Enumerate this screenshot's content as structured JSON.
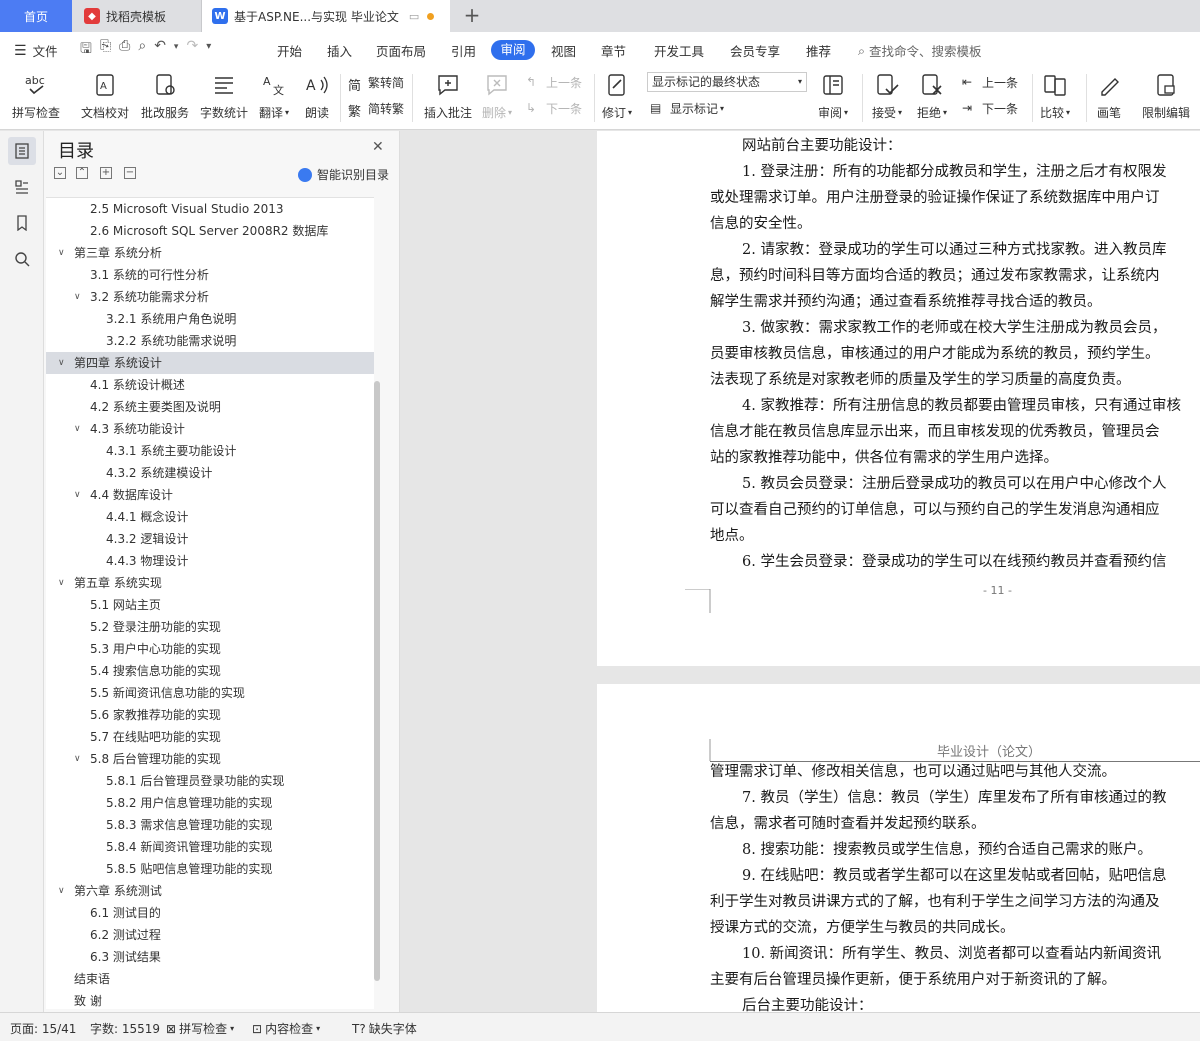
{
  "tabs": {
    "home": "首页",
    "template": "找稻壳模板",
    "doc": "基于ASP.NE...与实现 毕业论文"
  },
  "menu": {
    "file": "文件",
    "items": [
      "开始",
      "插入",
      "页面布局",
      "引用",
      "审阅",
      "视图",
      "章节",
      "开发工具",
      "会员专享",
      "推荐"
    ],
    "search": "查找命令、搜索模板"
  },
  "ribbon": {
    "spell": "拼写检查",
    "doccheck": "文档校对",
    "batch": "批改服务",
    "wordcount": "字数统计",
    "translate": "翻译",
    "read": "朗读",
    "trad": "繁转简",
    "simp": "简转繁",
    "comment": "插入批注",
    "delete": "删除",
    "prev": "上一条",
    "next": "下一条",
    "revise": "修订",
    "display_select": "显示标记的最终状态",
    "show_marks": "显示标记",
    "review": "审阅",
    "accept": "接受",
    "reject": "拒绝",
    "prev2": "上一条",
    "next2": "下一条",
    "compare": "比较",
    "pen": "画笔",
    "restrict": "限制编辑"
  },
  "toc": {
    "title": "目录",
    "smart": "智能识别目录",
    "items": [
      {
        "text": "2.5 Microsoft Visual Studio 2013",
        "level": 2,
        "arrow": ""
      },
      {
        "text": "2.6 Microsoft SQL Server 2008R2 数据库",
        "level": 2,
        "arrow": ""
      },
      {
        "text": "第三章  系统分析",
        "level": 1,
        "arrow": "v"
      },
      {
        "text": "3.1 系统的可行性分析",
        "level": 2,
        "arrow": ""
      },
      {
        "text": "3.2 系统功能需求分析",
        "level": 2,
        "arrow": "v"
      },
      {
        "text": "3.2.1 系统用户角色说明",
        "level": 3,
        "arrow": ""
      },
      {
        "text": "3.2.2 系统功能需求说明",
        "level": 3,
        "arrow": ""
      },
      {
        "text": "第四章  系统设计",
        "level": 1,
        "arrow": "v",
        "selected": true
      },
      {
        "text": "4.1 系统设计概述",
        "level": 2,
        "arrow": ""
      },
      {
        "text": "4.2  系统主要类图及说明",
        "level": 2,
        "arrow": ""
      },
      {
        "text": "4.3 系统功能设计",
        "level": 2,
        "arrow": "v"
      },
      {
        "text": "4.3.1 系统主要功能设计",
        "level": 3,
        "arrow": ""
      },
      {
        "text": "4.3.2 系统建模设计",
        "level": 3,
        "arrow": ""
      },
      {
        "text": "4.4 数据库设计",
        "level": 2,
        "arrow": "v"
      },
      {
        "text": "4.4.1  概念设计",
        "level": 3,
        "arrow": ""
      },
      {
        "text": "4.3.2  逻辑设计",
        "level": 3,
        "arrow": ""
      },
      {
        "text": "4.4.3  物理设计",
        "level": 3,
        "arrow": ""
      },
      {
        "text": "第五章  系统实现",
        "level": 1,
        "arrow": "v"
      },
      {
        "text": "5.1 网站主页",
        "level": 2,
        "arrow": ""
      },
      {
        "text": "5.2  登录注册功能的实现",
        "level": 2,
        "arrow": ""
      },
      {
        "text": "5.3 用户中心功能的实现",
        "level": 2,
        "arrow": ""
      },
      {
        "text": "5.4 搜索信息功能的实现",
        "level": 2,
        "arrow": ""
      },
      {
        "text": "5.5 新闻资讯信息功能的实现",
        "level": 2,
        "arrow": ""
      },
      {
        "text": "5.6 家教推荐功能的实现",
        "level": 2,
        "arrow": ""
      },
      {
        "text": "5.7 在线贴吧功能的实现",
        "level": 2,
        "arrow": ""
      },
      {
        "text": "5.8 后台管理功能的实现",
        "level": 2,
        "arrow": "v"
      },
      {
        "text": "5.8.1  后台管理员登录功能的实现",
        "level": 3,
        "arrow": ""
      },
      {
        "text": "5.8.2  用户信息管理功能的实现",
        "level": 3,
        "arrow": ""
      },
      {
        "text": "5.8.3  需求信息管理功能的实现",
        "level": 3,
        "arrow": ""
      },
      {
        "text": "5.8.4  新闻资讯管理功能的实现",
        "level": 3,
        "arrow": ""
      },
      {
        "text": "5.8.5  贴吧信息管理功能的实现",
        "level": 3,
        "arrow": ""
      },
      {
        "text": "第六章  系统测试",
        "level": 1,
        "arrow": "v"
      },
      {
        "text": "6.1  测试目的",
        "level": 2,
        "arrow": ""
      },
      {
        "text": "6.2  测试过程",
        "level": 2,
        "arrow": ""
      },
      {
        "text": "6.3  测试结果",
        "level": 2,
        "arrow": ""
      },
      {
        "text": "结束语",
        "level": 1,
        "arrow": ""
      },
      {
        "text": "致  谢",
        "level": 1,
        "arrow": ""
      }
    ]
  },
  "page1": {
    "lines": [
      {
        "t": "网站前台主要功能设计：",
        "in": true
      },
      {
        "t": "1. 登录注册：所有的功能都分成教员和学生，注册之后才有权限发",
        "in": true
      },
      {
        "t": "或处理需求订单。用户注册登录的验证操作保证了系统数据库中用户订",
        "in": false
      },
      {
        "t": "信息的安全性。",
        "in": false
      },
      {
        "t": "2. 请家教：登录成功的学生可以通过三种方式找家教。进入教员库",
        "in": true
      },
      {
        "t": "息，预约时间科目等方面均合适的教员；通过发布家教需求，让系统内",
        "in": false
      },
      {
        "t": "解学生需求并预约沟通；通过查看系统推荐寻找合适的教员。",
        "in": false
      },
      {
        "t": "3. 做家教：需求家教工作的老师或在校大学生注册成为教员会员，",
        "in": true
      },
      {
        "t": "员要审核教员信息，审核通过的用户才能成为系统的教员，预约学生。",
        "in": false
      },
      {
        "t": "法表现了系统是对家教老师的质量及学生的学习质量的高度负责。",
        "in": false
      },
      {
        "t": "4. 家教推荐：所有注册信息的教员都要由管理员审核，只有通过审核",
        "in": true
      },
      {
        "t": "信息才能在教员信息库显示出来，而且审核发现的优秀教员，管理员会",
        "in": false
      },
      {
        "t": "站的家教推荐功能中，供各位有需求的学生用户选择。",
        "in": false
      },
      {
        "t": "5. 教员会员登录：注册后登录成功的教员可以在用户中心修改个人",
        "in": true
      },
      {
        "t": "可以查看自己预约的订单信息，可以与预约自己的学生发消息沟通相应",
        "in": false
      },
      {
        "t": "地点。",
        "in": false
      },
      {
        "t": "6. 学生会员登录：登录成功的学生可以在线预约教员并查看预约信",
        "in": true
      }
    ],
    "page_number": "- 11 -"
  },
  "page2": {
    "header": "毕业设计（论文）",
    "lines": [
      {
        "t": "管理需求订单、修改相关信息，也可以通过贴吧与其他人交流。",
        "in": false
      },
      {
        "t": "7. 教员（学生）信息：教员（学生）库里发布了所有审核通过的教",
        "in": true
      },
      {
        "t": "信息，需求者可随时查看并发起预约联系。",
        "in": false
      },
      {
        "t": "8. 搜索功能：搜索教员或学生信息，预约合适自己需求的账户。",
        "in": true
      },
      {
        "t": "9. 在线贴吧：教员或者学生都可以在这里发帖或者回帖，贴吧信息",
        "in": true
      },
      {
        "t": "利于学生对教员讲课方式的了解，也有利于学生之间学习方法的沟通及",
        "in": false
      },
      {
        "t": "授课方式的交流，方便学生与教员的共同成长。",
        "in": false
      },
      {
        "t": "10. 新闻资讯：所有学生、教员、浏览者都可以查看站内新闻资讯",
        "in": true
      },
      {
        "t": "主要有后台管理员操作更新，便于系统用户对于新资讯的了解。",
        "in": false
      },
      {
        "t": "后台主要功能设计：",
        "in": true
      }
    ]
  },
  "status": {
    "page": "页面: 15/41",
    "words": "字数: 15519",
    "spell": "拼写检查",
    "content": "内容检查",
    "font": "缺失字体"
  }
}
